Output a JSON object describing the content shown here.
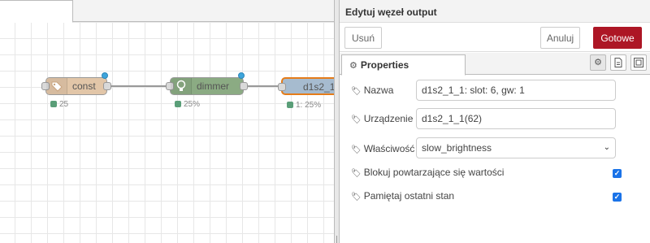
{
  "canvas": {
    "nodes": [
      {
        "label": "const",
        "status": "25",
        "icon": "tag-icon"
      },
      {
        "label": "dimmer",
        "status": "25%",
        "icon": "lightbulb-icon"
      },
      {
        "label": "d1s2_1_",
        "status": "1: 25%",
        "icon": "output-node"
      }
    ]
  },
  "editor": {
    "title": "Edytuj węzeł output",
    "buttons": {
      "delete": "Usuń",
      "cancel": "Anuluj",
      "done": "Gotowe"
    },
    "tabs": {
      "properties": "Properties"
    },
    "fields": {
      "name": {
        "label": "Nazwa",
        "value": "d1s2_1_1: slot: 6, gw: 1"
      },
      "device": {
        "label": "Urządzenie",
        "value": "d1s2_1_1(62)"
      },
      "property": {
        "label": "Właściwość",
        "value": "slow_brightness"
      },
      "block_repeats": {
        "label": "Blokuj powtarzające się wartości",
        "checked": true
      },
      "remember_state": {
        "label": "Pamiętaj ostatni stan",
        "checked": true
      }
    }
  },
  "colors": {
    "done_button": "#ad1625",
    "checkbox": "#1a73e8",
    "const_node": "#e2c6a8",
    "dimmer_node": "#8bab83",
    "output_node": "#a6bbcf",
    "selected_border": "#e57c19",
    "changed_indicator": "#3ea5dc",
    "status_dot": "#5a9e78"
  }
}
